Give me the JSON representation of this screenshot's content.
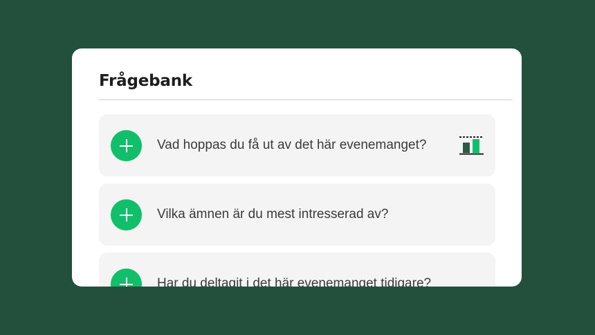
{
  "panel": {
    "title": "Frågebank"
  },
  "questions": [
    {
      "text": "Vad hoppas du få ut av det här evenemanget?",
      "icon": "bar-chart-icon"
    },
    {
      "text": "Vilka ämnen är du mest intresserad av?"
    },
    {
      "text": "Har du deltagit i det här evenemanget tidigare?"
    }
  ],
  "colors": {
    "background": "#22503c",
    "accent": "#11bf6a",
    "card": "#ffffff",
    "row": "#f4f4f4"
  }
}
